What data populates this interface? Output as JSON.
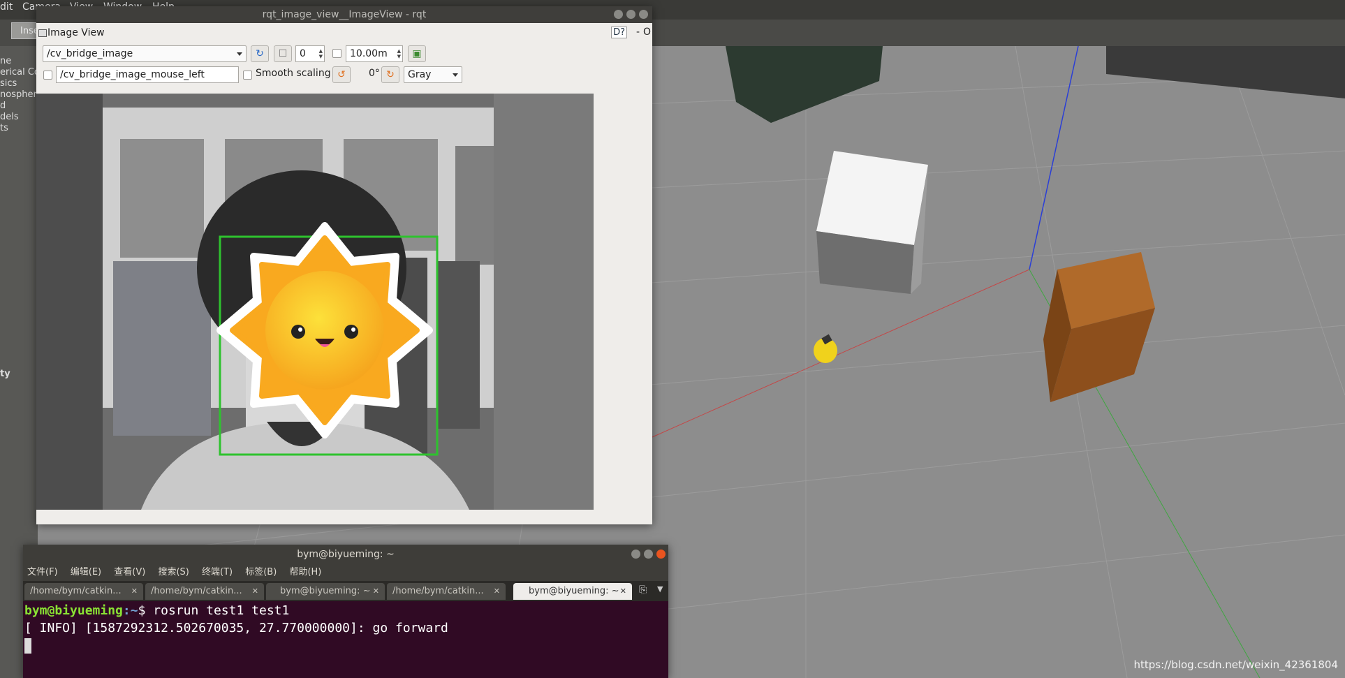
{
  "gazebo": {
    "menu": [
      "dit",
      "Camera",
      "View",
      "Window",
      "Help"
    ],
    "insert_tab": "Inse",
    "left_items": [
      "ne",
      "erical Co",
      "sics",
      "nosphere",
      "d",
      "dels",
      "ts"
    ],
    "left_footer": "ty"
  },
  "rqt": {
    "title": "rqt_image_view__ImageView - rqt",
    "plugin_title": "Image View",
    "help_buttons": "D?",
    "topic": "/cv_bridge_image",
    "frame_value": "0",
    "max_depth": "10.00m",
    "mouse_topic": "/cv_bridge_image_mouse_left",
    "smooth_scaling": "Smooth scaling",
    "rotation": "0°",
    "color_scheme": "Gray"
  },
  "terminal": {
    "title": "bym@biyueming: ~",
    "menu": [
      "文件(F)",
      "编辑(E)",
      "查看(V)",
      "搜索(S)",
      "终端(T)",
      "标签(B)",
      "帮助(H)"
    ],
    "tabs": [
      "/home/bym/catkin...",
      "/home/bym/catkin...",
      "bym@biyueming: ~",
      "/home/bym/catkin...",
      "bym@biyueming: ~"
    ],
    "prompt_user": "bym@biyueming",
    "prompt_path": ":~",
    "prompt_symbol": "$ ",
    "command": "rosrun test1 test1",
    "output": "[ INFO] [1587292312.502670035, 27.770000000]: go forward"
  },
  "watermark": "https://blog.csdn.net/weixin_42361804"
}
